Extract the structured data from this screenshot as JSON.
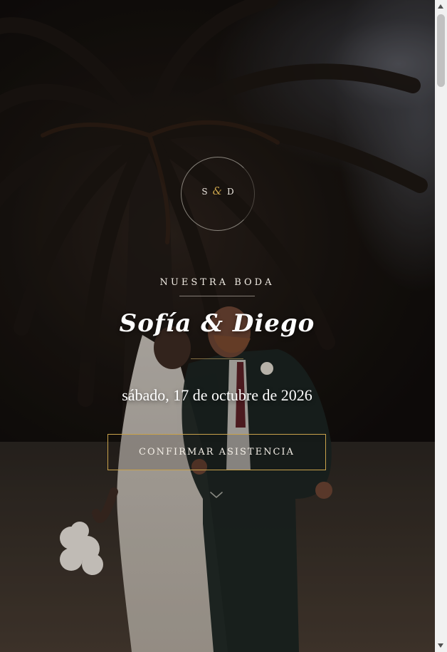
{
  "hero": {
    "monogram": {
      "left": "S",
      "amp": "&",
      "right": "D"
    },
    "kicker": "NUESTRA BODA",
    "names": "Sofía & Diego",
    "date": "sábado, 17 de octubre de 2026",
    "rsvp_label": "CONFIRMAR ASISTENCIA",
    "scroll_icon": "chevron-down-icon"
  },
  "colors": {
    "accent_gold": "#c9a24b",
    "text_light": "#f1ece4"
  },
  "scrollbar": {
    "position_fraction": 0.0
  }
}
